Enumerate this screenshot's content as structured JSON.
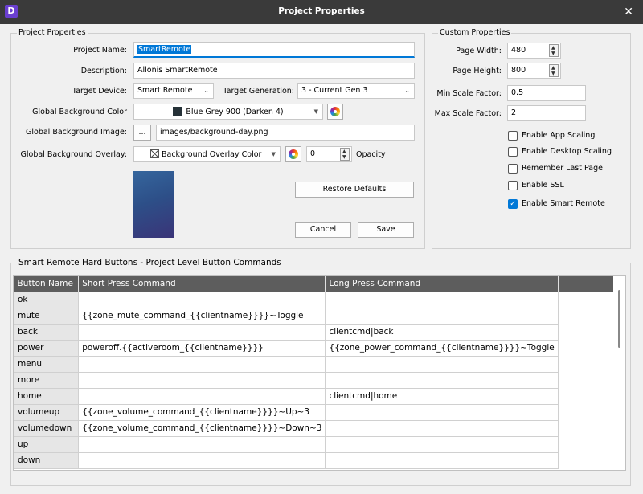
{
  "window": {
    "title": "Project Properties",
    "app_icon": "D",
    "close": "✕"
  },
  "project": {
    "group_title": "Project Properties",
    "name_label": "Project Name:",
    "name_value": "SmartRemote",
    "desc_label": "Description:",
    "desc_value": "Allonis SmartRemote",
    "device_label": "Target Device:",
    "device_value": "Smart Remote",
    "generation_label": "Target Generation:",
    "generation_value": "3 - Current Gen 3",
    "bgcolor_label": "Global Background Color",
    "bgcolor_value": "Blue Grey 900 (Darken 4)",
    "bgcolor_hex": "#263238",
    "bgimage_label": "Global Background Image:",
    "bgimage_browse": "...",
    "bgimage_value": "images/background-day.png",
    "overlay_label": "Global Background Overlay:",
    "overlay_value": "Background Overlay Color",
    "opacity_value": "0",
    "opacity_label": "Opacity",
    "restore_label": "Restore Defaults",
    "cancel_label": "Cancel",
    "save_label": "Save"
  },
  "custom": {
    "group_title": "Custom Properties",
    "width_label": "Page Width:",
    "width_value": "480",
    "height_label": "Page Height:",
    "height_value": "800",
    "min_label": "Min Scale Factor:",
    "min_value": "0.5",
    "max_label": "Max Scale Factor:",
    "max_value": "2",
    "checkboxes": [
      {
        "label": "Enable App Scaling",
        "checked": false
      },
      {
        "label": "Enable Desktop Scaling",
        "checked": false
      },
      {
        "label": "Remember Last Page",
        "checked": false
      },
      {
        "label": "Enable SSL",
        "checked": false
      },
      {
        "label": "Enable Smart Remote",
        "checked": true
      }
    ]
  },
  "buttons_table": {
    "group_title": "Smart Remote Hard Buttons - Project Level Button Commands",
    "columns": [
      "Button Name",
      "Short Press Command",
      "Long Press Command"
    ],
    "rows": [
      [
        "ok",
        "",
        ""
      ],
      [
        "mute",
        "{{zone_mute_command_{{clientname}}}}~Toggle",
        ""
      ],
      [
        "back",
        "",
        "clientcmd|back"
      ],
      [
        "power",
        "poweroff.{{activeroom_{{clientname}}}}",
        "{{zone_power_command_{{clientname}}}}~Toggle"
      ],
      [
        "menu",
        "",
        ""
      ],
      [
        "more",
        "",
        ""
      ],
      [
        "home",
        "",
        "clientcmd|home"
      ],
      [
        "volumeup",
        "{{zone_volume_command_{{clientname}}}}~Up~3",
        ""
      ],
      [
        "volumedown",
        "{{zone_volume_command_{{clientname}}}}~Down~3",
        ""
      ],
      [
        "up",
        "",
        ""
      ],
      [
        "down",
        "",
        ""
      ]
    ]
  }
}
